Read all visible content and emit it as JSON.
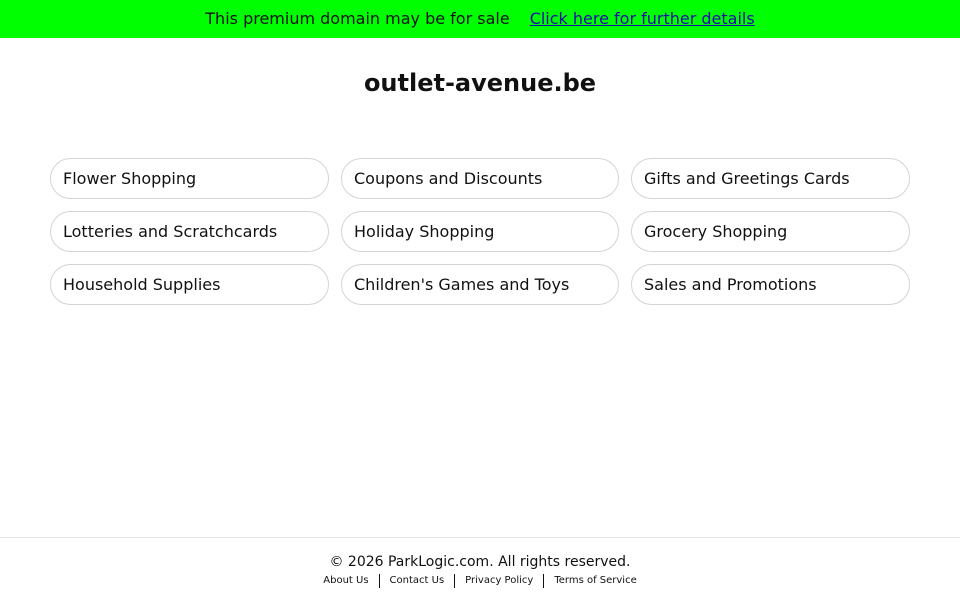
{
  "banner": {
    "text": "This premium domain may be for sale",
    "link": "Click here for further details",
    "background": "#00ff00",
    "link_color": "#1a0dab"
  },
  "site": {
    "title": "outlet-avenue.be"
  },
  "categories": [
    "Flower Shopping",
    "Coupons and Discounts",
    "Gifts and Greetings Cards",
    "Lotteries and Scratchcards",
    "Holiday Shopping",
    "Grocery Shopping",
    "Household Supplies",
    "Children's Games and Toys",
    "Sales and Promotions"
  ],
  "footer": {
    "copyright": "© 2026 ParkLogic.com. All rights reserved.",
    "links": [
      "About Us",
      "Contact Us",
      "Privacy Policy",
      "Terms of Service"
    ]
  }
}
